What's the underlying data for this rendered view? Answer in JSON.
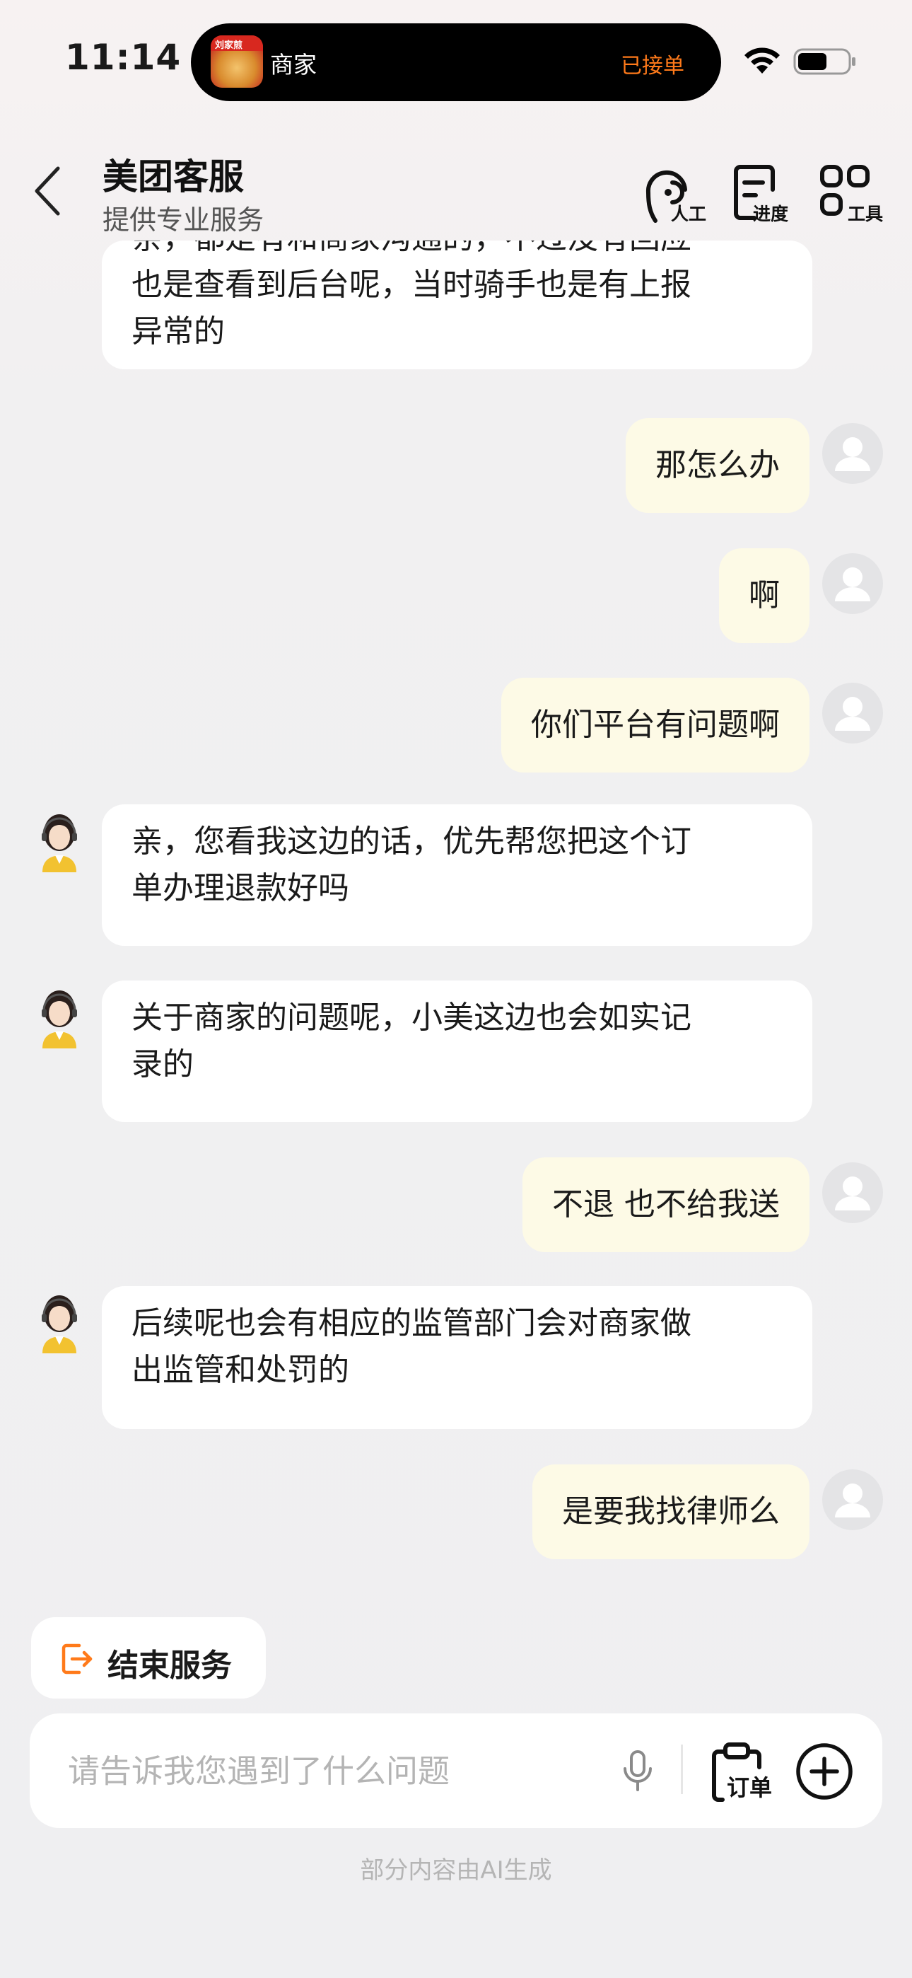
{
  "status_bar": {
    "time": "11:14",
    "island": {
      "app_badge": "刘家煎",
      "title": "商家",
      "status": "已接单",
      "status_color": "#ff7a1a"
    },
    "icons": [
      "wifi-icon",
      "battery-icon"
    ]
  },
  "header": {
    "title": "美团客服",
    "subtitle": "提供专业服务",
    "actions": [
      {
        "label": "人工",
        "icon": "agent-headset-icon"
      },
      {
        "label": "进度",
        "icon": "progress-doc-icon"
      },
      {
        "label": "工具",
        "icon": "tools-grid-icon"
      }
    ]
  },
  "messages": [
    {
      "sender": "agent",
      "lines": [
        "亲，都是有和商家沟通的，不过没有回应",
        "也是查看到后台呢，当时骑手也是有上报",
        "异常的"
      ]
    },
    {
      "sender": "user",
      "text": "那怎么办"
    },
    {
      "sender": "user",
      "text": "啊"
    },
    {
      "sender": "user",
      "text": "你们平台有问题啊"
    },
    {
      "sender": "agent",
      "lines": [
        "亲，您看我这边的话，优先帮您把这个订",
        "单办理退款好吗"
      ]
    },
    {
      "sender": "agent",
      "lines": [
        "关于商家的问题呢，小美这边也会如实记",
        "录的"
      ]
    },
    {
      "sender": "user",
      "text": "不退 也不给我送"
    },
    {
      "sender": "agent",
      "lines": [
        "后续呢也会有相应的监管部门会对商家做",
        "出监管和处罚的"
      ]
    },
    {
      "sender": "user",
      "text": "是要我找律师么"
    }
  ],
  "end_service": {
    "label": "结束服务",
    "icon": "exit-icon",
    "icon_color": "#ff7a1a"
  },
  "input": {
    "placeholder": "请告诉我您遇到了什么问题",
    "value": ""
  },
  "input_actions": {
    "order_label": "订单",
    "icons": [
      "microphone-icon",
      "order-clipboard-icon",
      "plus-icon"
    ]
  },
  "footer_note": "部分内容由AI生成",
  "colors": {
    "user_bubble": "#fdfae6",
    "agent_bubble": "#ffffff",
    "accent": "#ff7a1a"
  }
}
